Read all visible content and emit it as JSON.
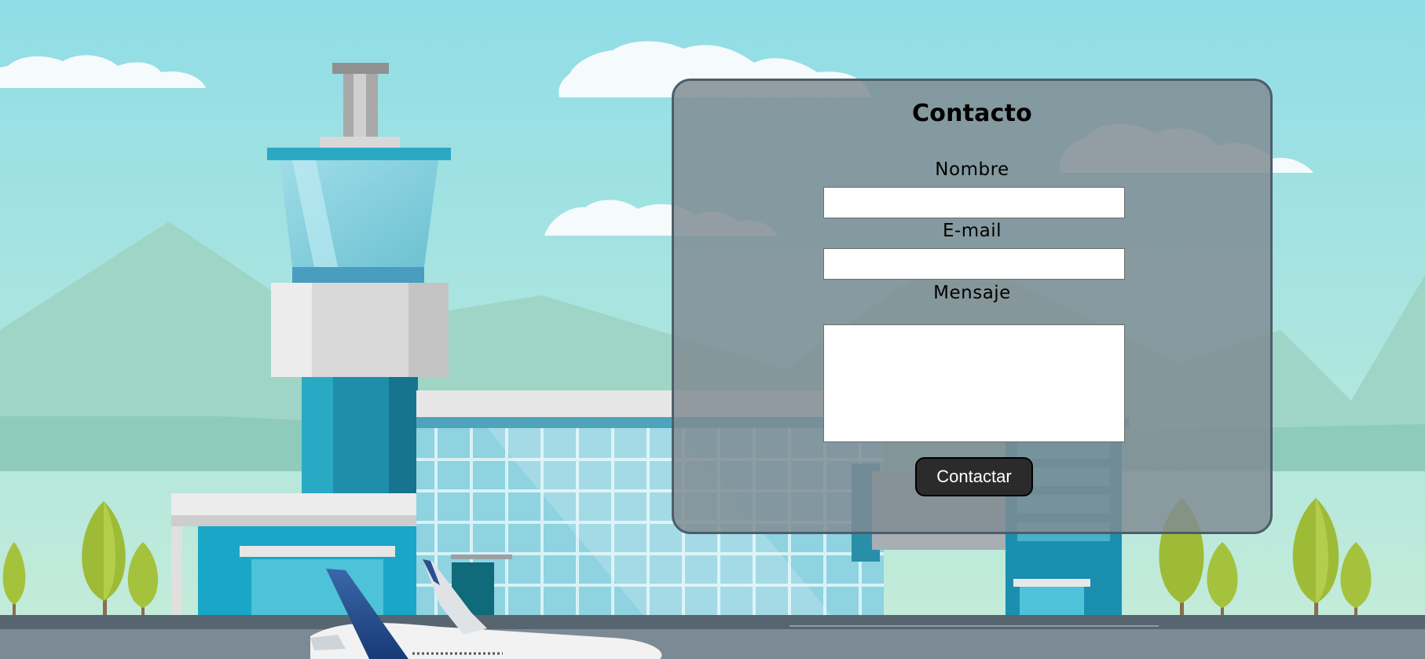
{
  "contact_form": {
    "title": "Contacto",
    "name_label": "Nombre",
    "name_value": "",
    "email_label": "E-mail",
    "email_value": "",
    "message_label": "Mensaje",
    "message_value": "",
    "submit_label": "Contactar"
  },
  "colors": {
    "sky_top": "#8fdbe6",
    "mountain": "#9cd3c4",
    "panel_border": "#4d5d6b",
    "button_bg": "#2b2b2b",
    "runway": "#7c8a96"
  }
}
